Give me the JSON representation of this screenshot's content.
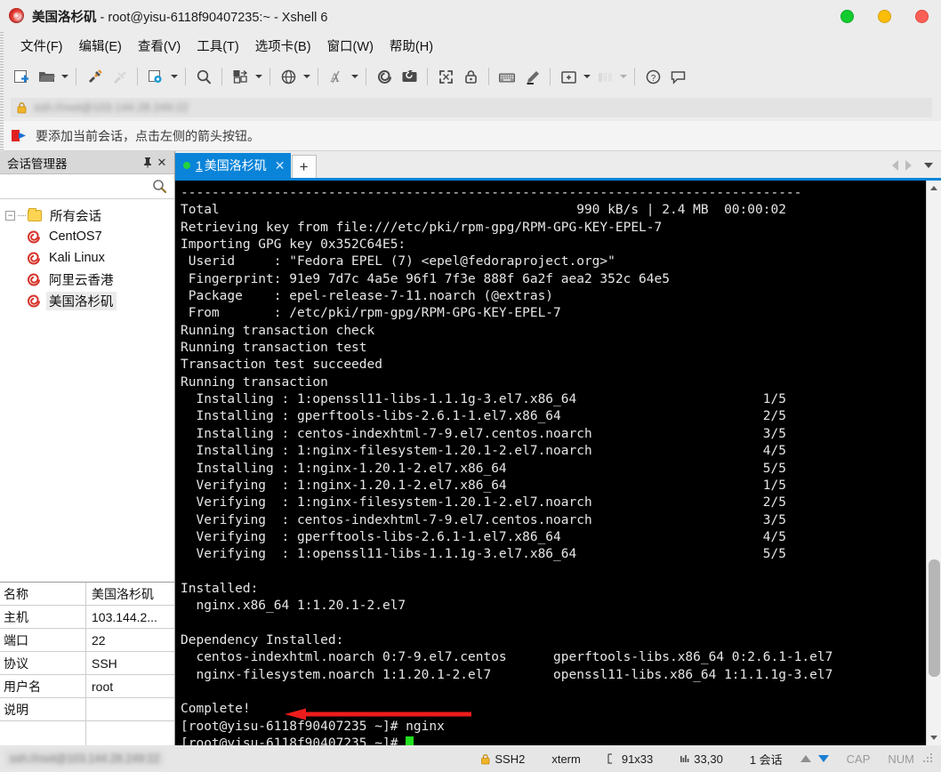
{
  "window": {
    "title_session": "美国洛杉矶",
    "title_rest": " - root@yisu-6118f90407235:~ - Xshell 6",
    "icon": "xshell-icon",
    "controls": [
      {
        "name": "minimize-button",
        "color": "#12cc2e"
      },
      {
        "name": "maximize-button",
        "color": "#fbbd08"
      },
      {
        "name": "close-button",
        "color": "#fc5f56"
      }
    ]
  },
  "menubar": {
    "items": [
      {
        "label": "文件(F)",
        "name": "menu-file"
      },
      {
        "label": "编辑(E)",
        "name": "menu-edit"
      },
      {
        "label": "查看(V)",
        "name": "menu-view"
      },
      {
        "label": "工具(T)",
        "name": "menu-tools"
      },
      {
        "label": "选项卡(B)",
        "name": "menu-tabs"
      },
      {
        "label": "窗口(W)",
        "name": "menu-window"
      },
      {
        "label": "帮助(H)",
        "name": "menu-help"
      }
    ]
  },
  "toolbar": {
    "icons": [
      "new-session-icon",
      "open-folder-icon",
      "connect-icon",
      "disconnect-icon",
      "session-properties-icon",
      "find-icon",
      "file-transfer-icon",
      "browser-icon",
      "font-icon",
      "shell-icon",
      "ftp-icon",
      "fullscreen-icon",
      "lock-icon",
      "keyboard-icon",
      "highlight-icon",
      "add-tab-icon",
      "layout-icon",
      "help-icon",
      "comment-icon"
    ]
  },
  "address_bar": {
    "icon": "lock-icon",
    "value": "ssh://root@103.144.28.249:22",
    "blurred": true
  },
  "hint_bar": {
    "icon": "red-arrow-flag-icon",
    "text": "要添加当前会话，点击左侧的箭头按钮。"
  },
  "session_manager": {
    "title": "会话管理器",
    "pin_glyph": "📌",
    "close_glyph": "✕",
    "search_icon": "search-icon",
    "root": {
      "label": "所有会话",
      "expander": "−",
      "icon": "folder-icon"
    },
    "sessions": [
      {
        "label": "CentOS7",
        "icon": "shell-icon",
        "selected": false
      },
      {
        "label": "Kali Linux",
        "icon": "shell-icon",
        "selected": false
      },
      {
        "label": "阿里云香港",
        "icon": "shell-icon",
        "selected": false
      },
      {
        "label": "美国洛杉矶",
        "icon": "shell-icon",
        "selected": true
      }
    ],
    "properties": [
      {
        "key": "名称",
        "value": "美国洛杉矶"
      },
      {
        "key": "主机",
        "value": "103.144.2..."
      },
      {
        "key": "端口",
        "value": "22"
      },
      {
        "key": "协议",
        "value": "SSH"
      },
      {
        "key": "用户名",
        "value": "root"
      },
      {
        "key": "说明",
        "value": ""
      }
    ]
  },
  "tabs": {
    "items": [
      {
        "index": "1",
        "label": "美国洛杉矶",
        "status_dot": "#24d13f",
        "active": true,
        "close_glyph": "✕"
      }
    ],
    "new_tab_glyph": "+",
    "scroll_left_icon": "chevron-left-icon",
    "scroll_right_icon": "chevron-right-icon",
    "tab_menu_icon": "chevron-down-icon"
  },
  "terminal": {
    "lines": [
      "--------------------------------------------------------------------------------",
      "Total                                              990 kB/s | 2.4 MB  00:00:02",
      "Retrieving key from file:///etc/pki/rpm-gpg/RPM-GPG-KEY-EPEL-7",
      "Importing GPG key 0x352C64E5:",
      " Userid     : \"Fedora EPEL (7) <epel@fedoraproject.org>\"",
      " Fingerprint: 91e9 7d7c 4a5e 96f1 7f3e 888f 6a2f aea2 352c 64e5",
      " Package    : epel-release-7-11.noarch (@extras)",
      " From       : /etc/pki/rpm-gpg/RPM-GPG-KEY-EPEL-7",
      "Running transaction check",
      "Running transaction test",
      "Transaction test succeeded",
      "Running transaction",
      "  Installing : 1:openssl11-libs-1.1.1g-3.el7.x86_64                        1/5",
      "  Installing : gperftools-libs-2.6.1-1.el7.x86_64                          2/5",
      "  Installing : centos-indexhtml-7-9.el7.centos.noarch                      3/5",
      "  Installing : 1:nginx-filesystem-1.20.1-2.el7.noarch                      4/5",
      "  Installing : 1:nginx-1.20.1-2.el7.x86_64                                 5/5",
      "  Verifying  : 1:nginx-1.20.1-2.el7.x86_64                                 1/5",
      "  Verifying  : 1:nginx-filesystem-1.20.1-2.el7.noarch                      2/5",
      "  Verifying  : centos-indexhtml-7-9.el7.centos.noarch                      3/5",
      "  Verifying  : gperftools-libs-2.6.1-1.el7.x86_64                          4/5",
      "  Verifying  : 1:openssl11-libs-1.1.1g-3.el7.x86_64                        5/5",
      "",
      "Installed:",
      "  nginx.x86_64 1:1.20.1-2.el7",
      "",
      "Dependency Installed:",
      "  centos-indexhtml.noarch 0:7-9.el7.centos      gperftools-libs.x86_64 0:2.6.1-1.el7",
      "  nginx-filesystem.noarch 1:1.20.1-2.el7        openssl11-libs.x86_64 1:1.1.1g-3.el7",
      "",
      "Complete!"
    ],
    "prompt_line": "[root@yisu-6118f90407235 ~]# nginx",
    "current_prompt": "[root@yisu-6118f90407235 ~]# ",
    "annotation_arrow_color": "#ee1c1c",
    "cursor_color": "#22e020"
  },
  "statusbar": {
    "left_text": "ssh://root@103.144.28.249:22",
    "left_blurred": true,
    "protocol_icon": "lock-icon",
    "protocol": "SSH2",
    "term_type": "xterm",
    "size_icon": "size-icon",
    "size": "91x33",
    "cursor_icon": "cursor-icon",
    "cursor_pos": "33,30",
    "sessions": "1 会话",
    "upload_icon": "arrow-up-icon",
    "download_icon": "arrow-down-icon",
    "cap": "CAP",
    "num": "NUM"
  }
}
